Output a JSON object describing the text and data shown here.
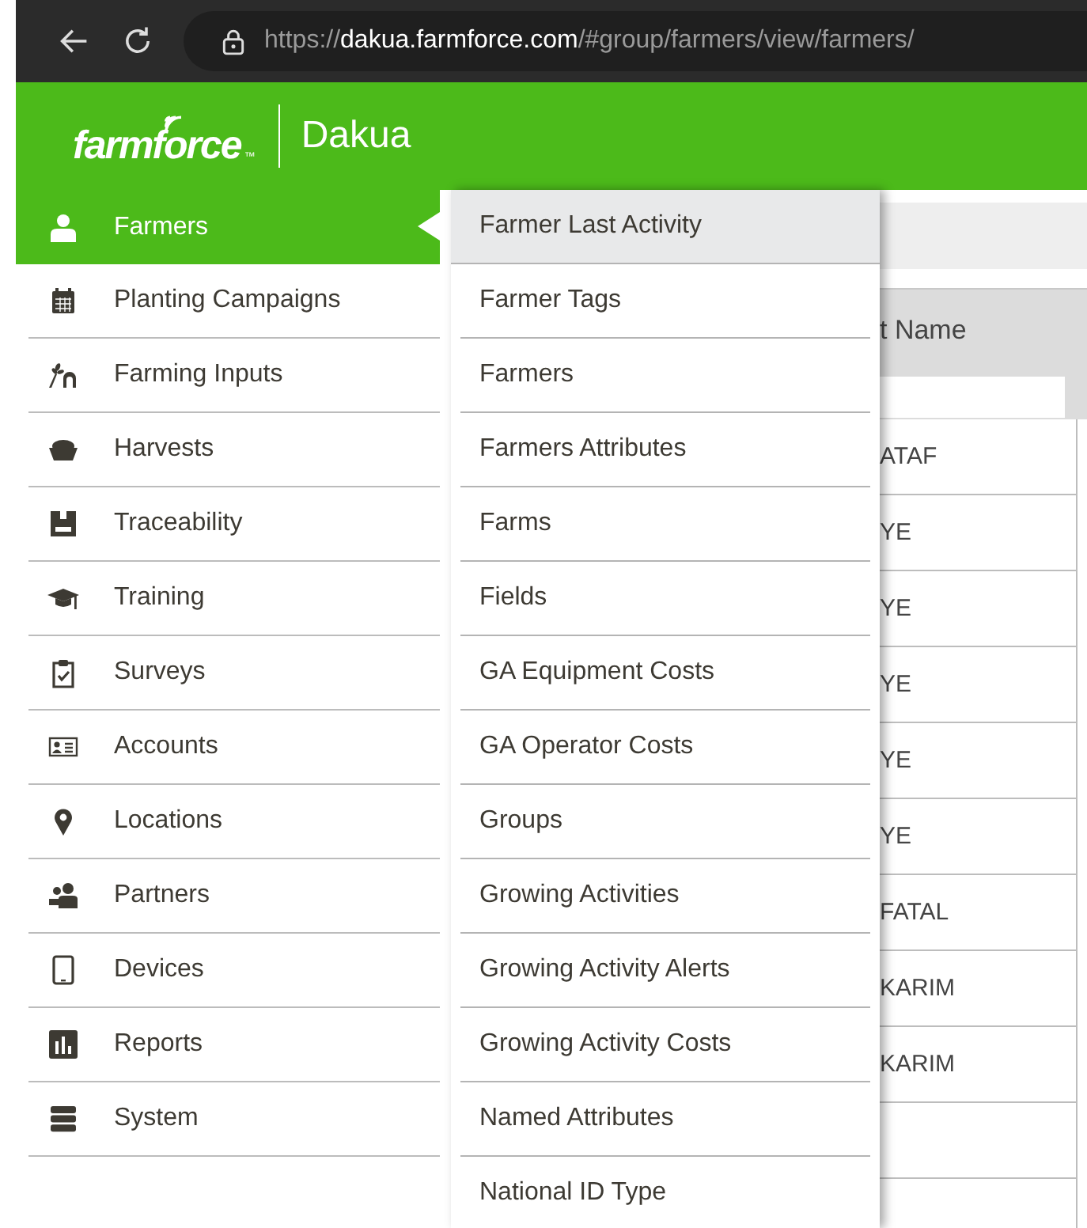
{
  "browser": {
    "url_prefix": "https://",
    "url_host": "dakua.farmforce.com",
    "url_path": "/#group/farmers/view/farmers/"
  },
  "header": {
    "logo": "farmforce",
    "logo_mark": "™",
    "org": "Dakua"
  },
  "sidebar": {
    "items": [
      {
        "label": "Farmers",
        "selected": true
      },
      {
        "label": "Planting Campaigns",
        "selected": false
      },
      {
        "label": "Farming Inputs",
        "selected": false
      },
      {
        "label": "Harvests",
        "selected": false
      },
      {
        "label": "Traceability",
        "selected": false
      },
      {
        "label": "Training",
        "selected": false
      },
      {
        "label": "Surveys",
        "selected": false
      },
      {
        "label": "Accounts",
        "selected": false
      },
      {
        "label": "Locations",
        "selected": false
      },
      {
        "label": "Partners",
        "selected": false
      },
      {
        "label": "Devices",
        "selected": false
      },
      {
        "label": "Reports",
        "selected": false
      },
      {
        "label": "System",
        "selected": false
      }
    ]
  },
  "submenu": {
    "items": [
      {
        "label": "Farmer Last Activity",
        "selected": true
      },
      {
        "label": "Farmer Tags",
        "selected": false
      },
      {
        "label": "Farmers",
        "selected": false
      },
      {
        "label": "Farmers Attributes",
        "selected": false
      },
      {
        "label": "Farms",
        "selected": false
      },
      {
        "label": "Fields",
        "selected": false
      },
      {
        "label": "GA Equipment Costs",
        "selected": false
      },
      {
        "label": "GA Operator Costs",
        "selected": false
      },
      {
        "label": "Groups",
        "selected": false
      },
      {
        "label": "Growing Activities",
        "selected": false
      },
      {
        "label": "Growing Activity Alerts",
        "selected": false
      },
      {
        "label": "Growing Activity Costs",
        "selected": false
      },
      {
        "label": "Named Attributes",
        "selected": false
      },
      {
        "label": "National ID Type",
        "selected": false
      }
    ]
  },
  "table": {
    "column_heading": "t Name",
    "rows": [
      "ATAF",
      "YE",
      "YE",
      "YE",
      "YE",
      "YE",
      "FATAL",
      "KARIM",
      "KARIM"
    ]
  }
}
